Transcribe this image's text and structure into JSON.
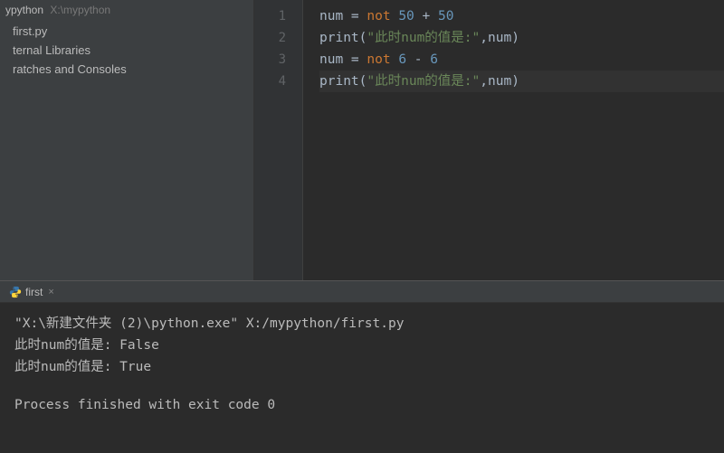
{
  "project": {
    "name": "ypython",
    "path": "X:\\mypython"
  },
  "tree": {
    "items": [
      {
        "label": "first.py"
      },
      {
        "label": "ternal Libraries"
      },
      {
        "label": "ratches and Consoles"
      }
    ]
  },
  "editor": {
    "lines": [
      {
        "tokens": [
          {
            "t": "var",
            "v": "num "
          },
          {
            "t": "op",
            "v": "= "
          },
          {
            "t": "kw",
            "v": "not "
          },
          {
            "t": "num",
            "v": "50"
          },
          {
            "t": "op",
            "v": " + "
          },
          {
            "t": "num",
            "v": "50"
          }
        ]
      },
      {
        "tokens": [
          {
            "t": "fn",
            "v": "print"
          },
          {
            "t": "paren",
            "v": "("
          },
          {
            "t": "str",
            "v": "\"此时num的值是:\""
          },
          {
            "t": "op",
            "v": ","
          },
          {
            "t": "var",
            "v": "num"
          },
          {
            "t": "paren",
            "v": ")"
          }
        ]
      },
      {
        "tokens": [
          {
            "t": "var",
            "v": "num "
          },
          {
            "t": "op",
            "v": "= "
          },
          {
            "t": "kw",
            "v": "not "
          },
          {
            "t": "num",
            "v": "6"
          },
          {
            "t": "op",
            "v": " - "
          },
          {
            "t": "num",
            "v": "6"
          }
        ]
      },
      {
        "current": true,
        "tokens": [
          {
            "t": "fn",
            "v": "print"
          },
          {
            "t": "paren",
            "v": "("
          },
          {
            "t": "str",
            "v": "\"此时num的值是:\""
          },
          {
            "t": "op",
            "v": ","
          },
          {
            "t": "var",
            "v": "num"
          },
          {
            "t": "paren",
            "v": ")"
          }
        ]
      }
    ],
    "line_numbers": [
      "1",
      "2",
      "3",
      "4"
    ]
  },
  "run_tab": {
    "label": "first"
  },
  "console": {
    "lines": [
      "\"X:\\新建文件夹 (2)\\python.exe\" X:/mypython/first.py",
      "此时num的值是: False",
      "此时num的值是: True",
      "",
      "Process finished with exit code 0"
    ]
  }
}
